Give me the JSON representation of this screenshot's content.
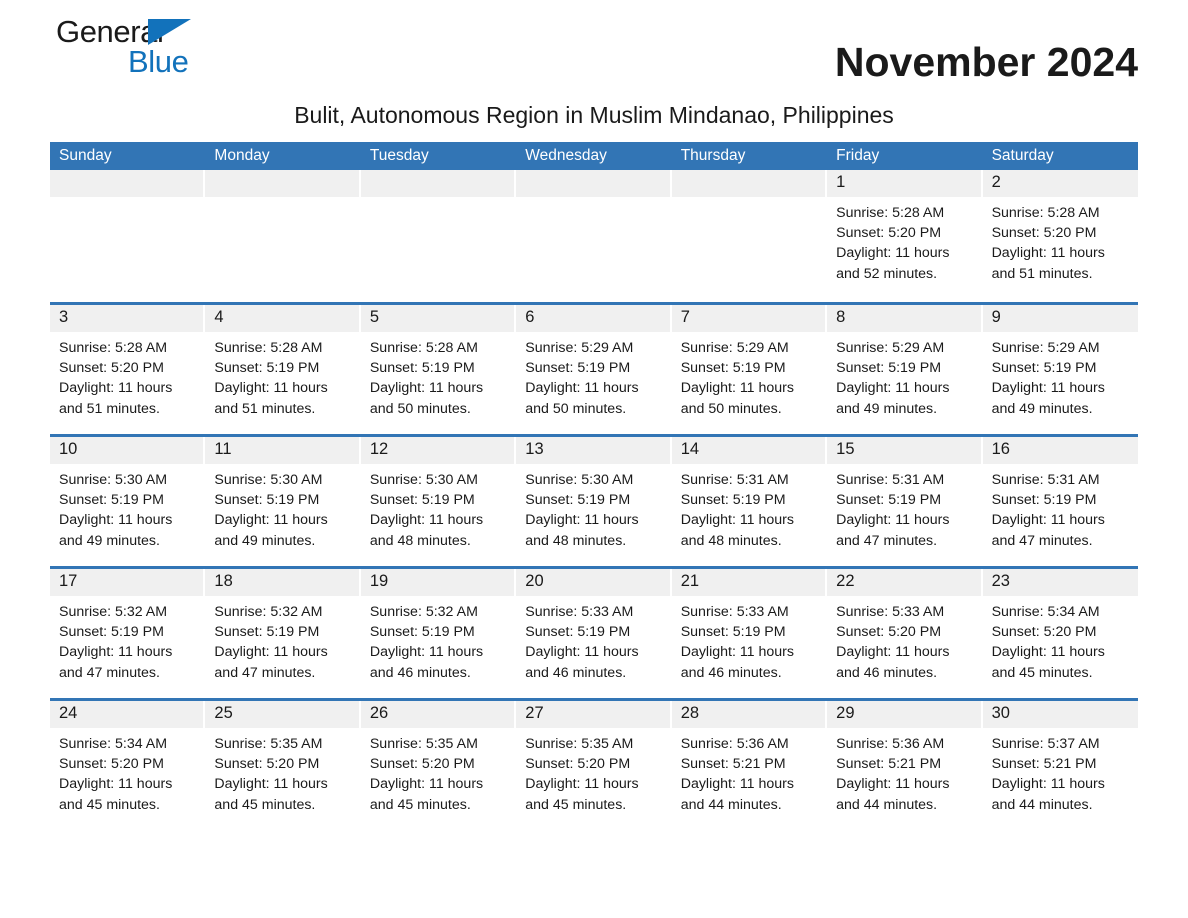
{
  "brand": {
    "name_part1": "General",
    "name_part2": "Blue",
    "triangle_color": "#1272bb",
    "accent_color": "#3275b5"
  },
  "header": {
    "month_title": "November 2024",
    "location": "Bulit, Autonomous Region in Muslim Mindanao, Philippines"
  },
  "calendar": {
    "weekdays": [
      "Sunday",
      "Monday",
      "Tuesday",
      "Wednesday",
      "Thursday",
      "Friday",
      "Saturday"
    ],
    "labels": {
      "sunrise": "Sunrise:",
      "sunset": "Sunset:",
      "daylight": "Daylight:"
    },
    "weeks": [
      [
        {
          "day": "",
          "sunrise": "",
          "sunset": "",
          "daylight": ""
        },
        {
          "day": "",
          "sunrise": "",
          "sunset": "",
          "daylight": ""
        },
        {
          "day": "",
          "sunrise": "",
          "sunset": "",
          "daylight": ""
        },
        {
          "day": "",
          "sunrise": "",
          "sunset": "",
          "daylight": ""
        },
        {
          "day": "",
          "sunrise": "",
          "sunset": "",
          "daylight": ""
        },
        {
          "day": "1",
          "sunrise": "Sunrise: 5:28 AM",
          "sunset": "Sunset: 5:20 PM",
          "daylight": "Daylight: 11 hours and 52 minutes."
        },
        {
          "day": "2",
          "sunrise": "Sunrise: 5:28 AM",
          "sunset": "Sunset: 5:20 PM",
          "daylight": "Daylight: 11 hours and 51 minutes."
        }
      ],
      [
        {
          "day": "3",
          "sunrise": "Sunrise: 5:28 AM",
          "sunset": "Sunset: 5:20 PM",
          "daylight": "Daylight: 11 hours and 51 minutes."
        },
        {
          "day": "4",
          "sunrise": "Sunrise: 5:28 AM",
          "sunset": "Sunset: 5:19 PM",
          "daylight": "Daylight: 11 hours and 51 minutes."
        },
        {
          "day": "5",
          "sunrise": "Sunrise: 5:28 AM",
          "sunset": "Sunset: 5:19 PM",
          "daylight": "Daylight: 11 hours and 50 minutes."
        },
        {
          "day": "6",
          "sunrise": "Sunrise: 5:29 AM",
          "sunset": "Sunset: 5:19 PM",
          "daylight": "Daylight: 11 hours and 50 minutes."
        },
        {
          "day": "7",
          "sunrise": "Sunrise: 5:29 AM",
          "sunset": "Sunset: 5:19 PM",
          "daylight": "Daylight: 11 hours and 50 minutes."
        },
        {
          "day": "8",
          "sunrise": "Sunrise: 5:29 AM",
          "sunset": "Sunset: 5:19 PM",
          "daylight": "Daylight: 11 hours and 49 minutes."
        },
        {
          "day": "9",
          "sunrise": "Sunrise: 5:29 AM",
          "sunset": "Sunset: 5:19 PM",
          "daylight": "Daylight: 11 hours and 49 minutes."
        }
      ],
      [
        {
          "day": "10",
          "sunrise": "Sunrise: 5:30 AM",
          "sunset": "Sunset: 5:19 PM",
          "daylight": "Daylight: 11 hours and 49 minutes."
        },
        {
          "day": "11",
          "sunrise": "Sunrise: 5:30 AM",
          "sunset": "Sunset: 5:19 PM",
          "daylight": "Daylight: 11 hours and 49 minutes."
        },
        {
          "day": "12",
          "sunrise": "Sunrise: 5:30 AM",
          "sunset": "Sunset: 5:19 PM",
          "daylight": "Daylight: 11 hours and 48 minutes."
        },
        {
          "day": "13",
          "sunrise": "Sunrise: 5:30 AM",
          "sunset": "Sunset: 5:19 PM",
          "daylight": "Daylight: 11 hours and 48 minutes."
        },
        {
          "day": "14",
          "sunrise": "Sunrise: 5:31 AM",
          "sunset": "Sunset: 5:19 PM",
          "daylight": "Daylight: 11 hours and 48 minutes."
        },
        {
          "day": "15",
          "sunrise": "Sunrise: 5:31 AM",
          "sunset": "Sunset: 5:19 PM",
          "daylight": "Daylight: 11 hours and 47 minutes."
        },
        {
          "day": "16",
          "sunrise": "Sunrise: 5:31 AM",
          "sunset": "Sunset: 5:19 PM",
          "daylight": "Daylight: 11 hours and 47 minutes."
        }
      ],
      [
        {
          "day": "17",
          "sunrise": "Sunrise: 5:32 AM",
          "sunset": "Sunset: 5:19 PM",
          "daylight": "Daylight: 11 hours and 47 minutes."
        },
        {
          "day": "18",
          "sunrise": "Sunrise: 5:32 AM",
          "sunset": "Sunset: 5:19 PM",
          "daylight": "Daylight: 11 hours and 47 minutes."
        },
        {
          "day": "19",
          "sunrise": "Sunrise: 5:32 AM",
          "sunset": "Sunset: 5:19 PM",
          "daylight": "Daylight: 11 hours and 46 minutes."
        },
        {
          "day": "20",
          "sunrise": "Sunrise: 5:33 AM",
          "sunset": "Sunset: 5:19 PM",
          "daylight": "Daylight: 11 hours and 46 minutes."
        },
        {
          "day": "21",
          "sunrise": "Sunrise: 5:33 AM",
          "sunset": "Sunset: 5:19 PM",
          "daylight": "Daylight: 11 hours and 46 minutes."
        },
        {
          "day": "22",
          "sunrise": "Sunrise: 5:33 AM",
          "sunset": "Sunset: 5:20 PM",
          "daylight": "Daylight: 11 hours and 46 minutes."
        },
        {
          "day": "23",
          "sunrise": "Sunrise: 5:34 AM",
          "sunset": "Sunset: 5:20 PM",
          "daylight": "Daylight: 11 hours and 45 minutes."
        }
      ],
      [
        {
          "day": "24",
          "sunrise": "Sunrise: 5:34 AM",
          "sunset": "Sunset: 5:20 PM",
          "daylight": "Daylight: 11 hours and 45 minutes."
        },
        {
          "day": "25",
          "sunrise": "Sunrise: 5:35 AM",
          "sunset": "Sunset: 5:20 PM",
          "daylight": "Daylight: 11 hours and 45 minutes."
        },
        {
          "day": "26",
          "sunrise": "Sunrise: 5:35 AM",
          "sunset": "Sunset: 5:20 PM",
          "daylight": "Daylight: 11 hours and 45 minutes."
        },
        {
          "day": "27",
          "sunrise": "Sunrise: 5:35 AM",
          "sunset": "Sunset: 5:20 PM",
          "daylight": "Daylight: 11 hours and 45 minutes."
        },
        {
          "day": "28",
          "sunrise": "Sunrise: 5:36 AM",
          "sunset": "Sunset: 5:21 PM",
          "daylight": "Daylight: 11 hours and 44 minutes."
        },
        {
          "day": "29",
          "sunrise": "Sunrise: 5:36 AM",
          "sunset": "Sunset: 5:21 PM",
          "daylight": "Daylight: 11 hours and 44 minutes."
        },
        {
          "day": "30",
          "sunrise": "Sunrise: 5:37 AM",
          "sunset": "Sunset: 5:21 PM",
          "daylight": "Daylight: 11 hours and 44 minutes."
        }
      ]
    ]
  }
}
